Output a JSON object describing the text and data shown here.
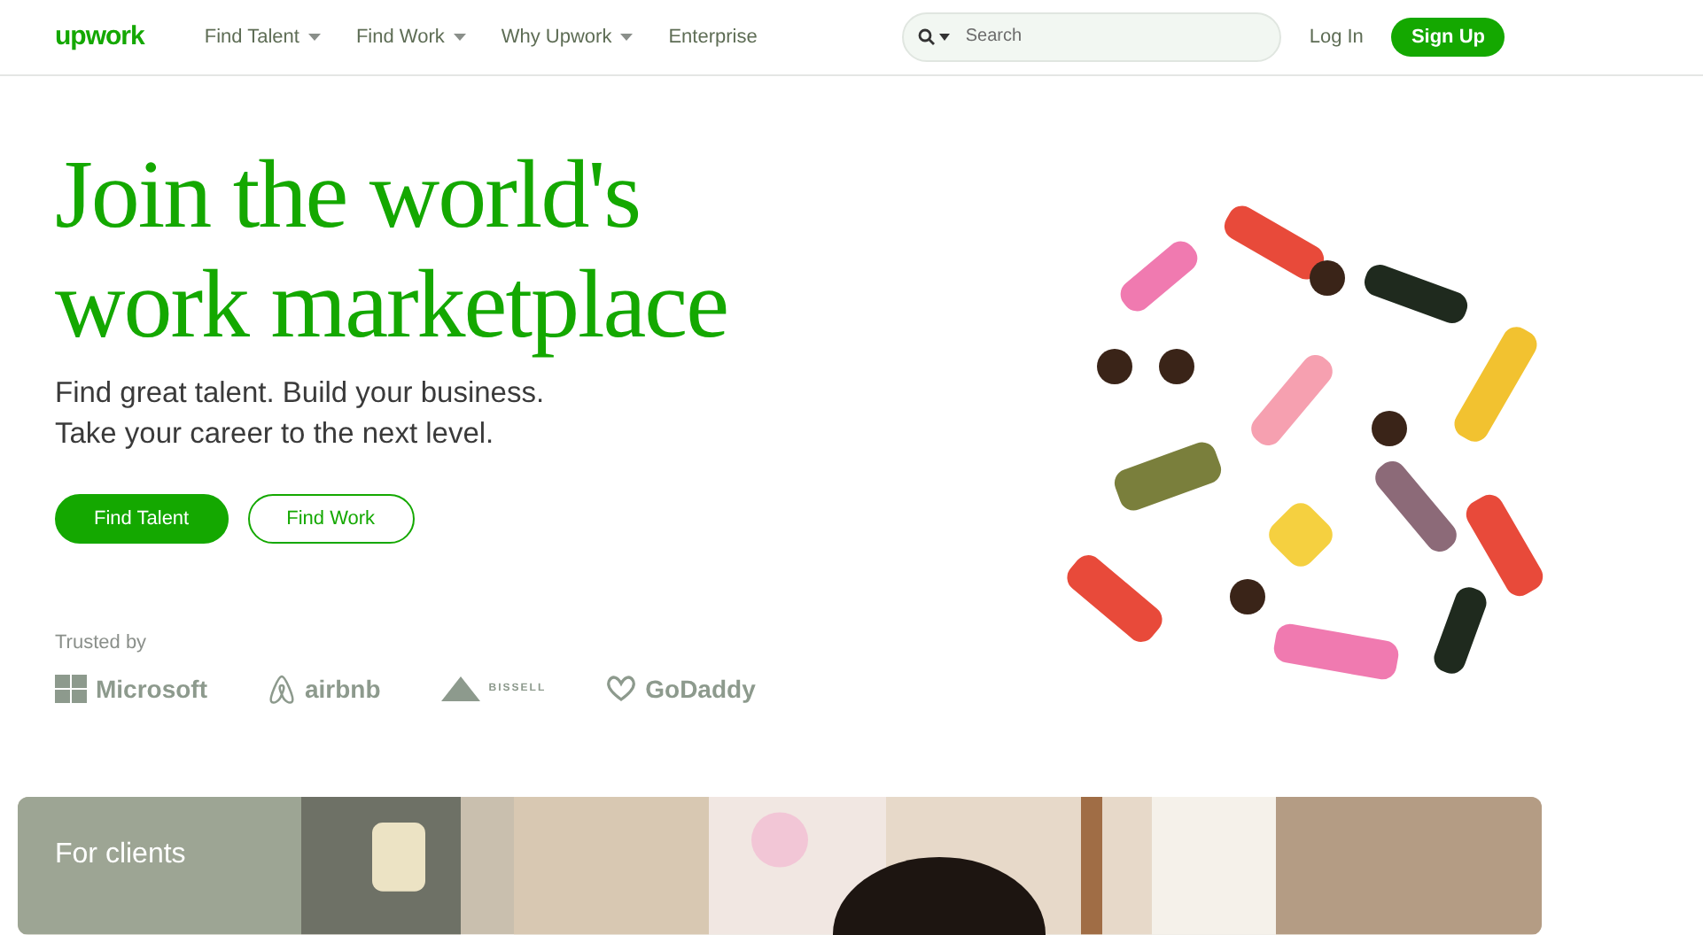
{
  "header": {
    "logo": "upwork",
    "nav": [
      {
        "label": "Find Talent",
        "dropdown": true
      },
      {
        "label": "Find Work",
        "dropdown": true
      },
      {
        "label": "Why Upwork",
        "dropdown": true
      },
      {
        "label": "Enterprise",
        "dropdown": false
      }
    ],
    "search": {
      "placeholder": "Search"
    },
    "login": "Log In",
    "signup": "Sign Up"
  },
  "hero": {
    "title_lines": [
      "Join the world's",
      "work marketplace"
    ],
    "subtitle_lines": [
      "Find great talent. Build your business.",
      "Take your career to the next level."
    ],
    "buttons": [
      {
        "label": "Find Talent",
        "kind": "primary"
      },
      {
        "label": "Find Work",
        "kind": "outline"
      }
    ],
    "trusted_label": "Trusted by",
    "logos": [
      {
        "name": "Microsoft",
        "kind": "windows"
      },
      {
        "name": "airbnb",
        "kind": "loop"
      },
      {
        "name": "BISSELL",
        "kind": "triangle"
      },
      {
        "name": "GoDaddy",
        "kind": "heart"
      }
    ]
  },
  "clients_card": {
    "title": "For clients"
  }
}
